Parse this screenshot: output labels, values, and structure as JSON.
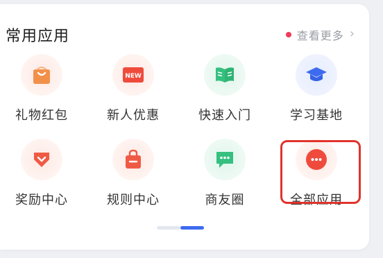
{
  "section": {
    "title": "常用应用",
    "more_label": "查看更多",
    "more_dot_color": "#ee3b5b"
  },
  "apps": [
    {
      "label": "礼物红包",
      "icon": "gift-bag-icon",
      "color": "#f2904a"
    },
    {
      "label": "新人优惠",
      "icon": "new-badge-icon",
      "color": "#ef4b3d"
    },
    {
      "label": "快速入门",
      "icon": "open-book-icon",
      "color": "#35c07f"
    },
    {
      "label": "学习基地",
      "icon": "graduation-cap-icon",
      "color": "#3d6bf0"
    },
    {
      "label": "奖励中心",
      "icon": "reward-heart-icon",
      "color": "#ef5a45"
    },
    {
      "label": "规则中心",
      "icon": "rules-bag-icon",
      "color": "#ef5a45"
    },
    {
      "label": "商友圈",
      "icon": "chat-bubble-icon",
      "color": "#35c07f"
    },
    {
      "label": "全部应用",
      "icon": "more-dots-icon",
      "color": "#ef4b3d"
    }
  ],
  "badge_text": "NEW",
  "pager": {
    "pages": 2,
    "active_index": 1,
    "active_color": "#3d6bf0"
  },
  "highlight_color": "#e0342c"
}
